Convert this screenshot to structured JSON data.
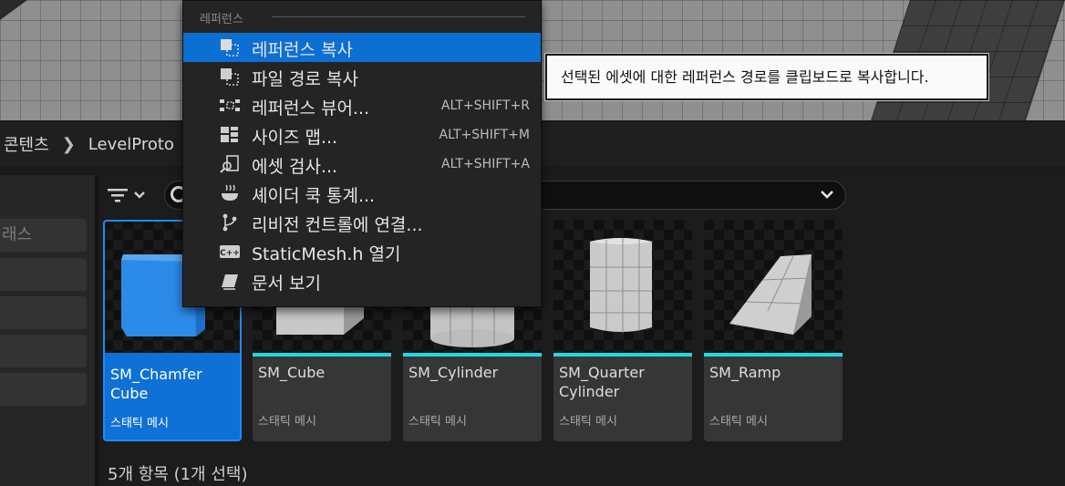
{
  "breadcrumb": {
    "items": [
      "콘텐츠",
      "LevelProto"
    ]
  },
  "left_panel": {
    "search_placeholder": "래스"
  },
  "assets": [
    {
      "name_line1": "SM_Chamfer",
      "name_line2": "Cube",
      "type": "스태틱 메시",
      "selected": true
    },
    {
      "name_line1": "SM_Cube",
      "name_line2": "",
      "type": "스태틱 메시",
      "selected": false
    },
    {
      "name_line1": "SM_Cylinder",
      "name_line2": "",
      "type": "스태틱 메시",
      "selected": false
    },
    {
      "name_line1": "SM_Quarter",
      "name_line2": "Cylinder",
      "type": "스태틱 메시",
      "selected": false
    },
    {
      "name_line1": "SM_Ramp",
      "name_line2": "",
      "type": "스태틱 메시",
      "selected": false
    }
  ],
  "status": {
    "text": "5개 항목 (1개 선택)"
  },
  "context_menu": {
    "section": "레퍼런스",
    "items": [
      {
        "label": "레퍼런스 복사",
        "shortcut": "",
        "icon": "copy-reference-icon",
        "highlighted": true
      },
      {
        "label": "파일 경로 복사",
        "shortcut": "",
        "icon": "copy-path-icon",
        "highlighted": false
      },
      {
        "label": "레퍼런스 뷰어...",
        "shortcut": "ALT+SHIFT+R",
        "icon": "reference-viewer-icon",
        "highlighted": false
      },
      {
        "label": "사이즈 맵...",
        "shortcut": "ALT+SHIFT+M",
        "icon": "size-map-icon",
        "highlighted": false
      },
      {
        "label": "에셋 검사...",
        "shortcut": "ALT+SHIFT+A",
        "icon": "audit-asset-icon",
        "highlighted": false
      },
      {
        "label": "셰이더 쿡 통계...",
        "shortcut": "",
        "icon": "shader-cook-icon",
        "highlighted": false
      },
      {
        "label": "리비전 컨트롤에 연결...",
        "shortcut": "",
        "icon": "revision-control-icon",
        "highlighted": false
      },
      {
        "label": "StaticMesh.h 열기",
        "shortcut": "",
        "icon": "cpp-icon",
        "highlighted": false
      },
      {
        "label": "문서 보기",
        "shortcut": "",
        "icon": "documentation-icon",
        "highlighted": false
      }
    ]
  },
  "tooltip": {
    "text": "선택된 에셋에 대한 레퍼런스 경로를 클립보드로 복사합니다."
  },
  "colors": {
    "accent": "#0c6fd4",
    "static_mesh_bar": "#20d8e8"
  }
}
